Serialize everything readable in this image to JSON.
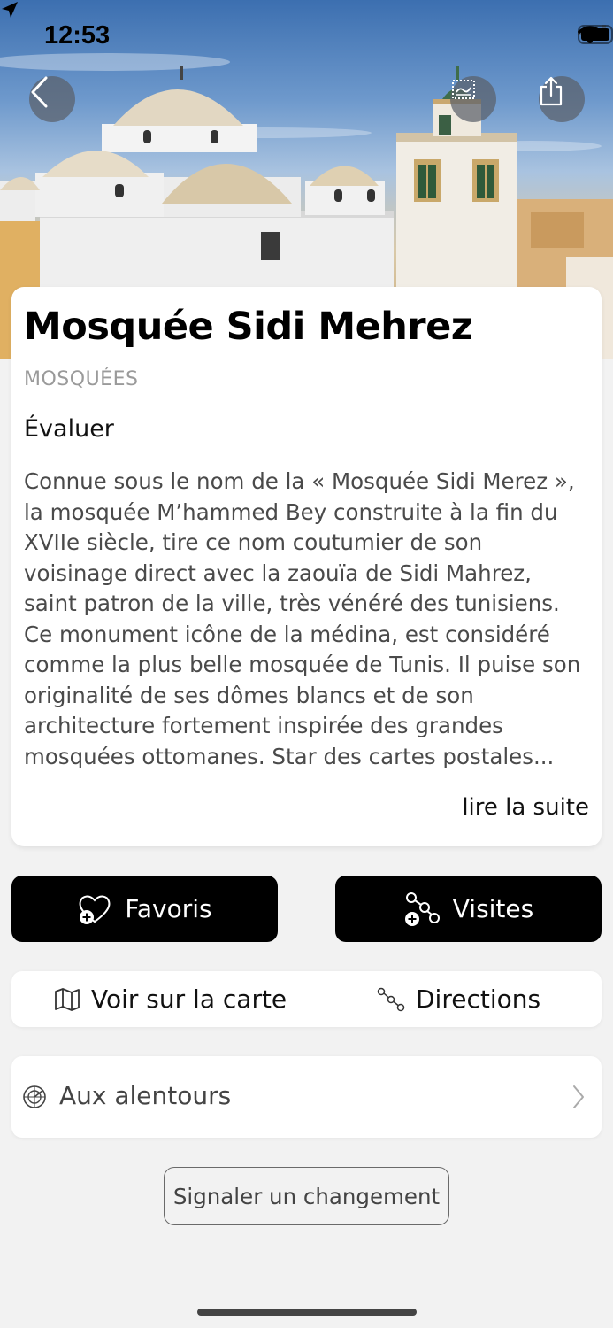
{
  "status_bar": {
    "time": "12:53"
  },
  "header": {
    "back_icon": "chevron-left-icon",
    "stamp_icon": "postage-stamp-icon",
    "share_icon": "share-icon"
  },
  "place": {
    "title": "Mosquée Sidi Mehrez",
    "category": "MOSQUÉES",
    "rate_label": "Évaluer",
    "description_lines": [
      "Connue sous le nom de la « Mosquée Sidi Merez »,",
      "la mosquée M’hammed Bey construite à la fin du",
      "XVIIe siècle, tire ce nom coutumier de son",
      "voisinage direct avec la zaouïa de Sidi Mahrez,",
      "saint patron de la ville, très vénéré des tunisiens.",
      "Ce monument icône de la médina, est considéré",
      "comme la plus belle mosquée de Tunis. Il puise son",
      "originalité de ses dômes blancs et de son",
      "architecture fortement inspirée des grandes",
      "mosquées ottomanes. Star des cartes postales..."
    ],
    "read_more_label": "lire la suite"
  },
  "actions": {
    "favorites_label": "Favoris",
    "visits_label": "Visites",
    "map_label": "Voir sur la carte",
    "directions_label": "Directions",
    "nearby_label": "Aux alentours",
    "report_label": "Signaler un changement"
  },
  "colors": {
    "background": "#f2f2f2",
    "card": "#ffffff",
    "primary_button": "#000000",
    "category_text": "#9a9a9a"
  }
}
